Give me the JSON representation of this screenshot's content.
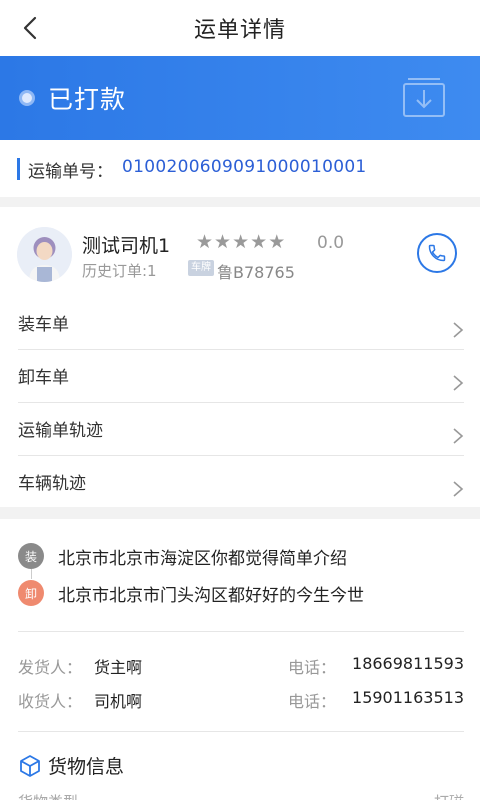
{
  "nav": {
    "title": "运单详情",
    "back_icon": "chevron-left-icon"
  },
  "status": {
    "text": "已打款",
    "icon": "download-box-icon"
  },
  "order": {
    "label": "运输单号：",
    "number": "010020060909100001 0001"
  },
  "driver": {
    "name": "测试司机1",
    "stars": [
      "★",
      "★",
      "★",
      "★",
      "★"
    ],
    "rating": "0.0",
    "history": "历史订单:1",
    "plate_tag": "车牌",
    "plate": "鲁B78765",
    "phone_icon": "phone-icon"
  },
  "menu": [
    {
      "label": "装车单"
    },
    {
      "label": "卸车单"
    },
    {
      "label": "运输单轨迹"
    },
    {
      "label": "车辆轨迹"
    }
  ],
  "addresses": {
    "load_badge": "装",
    "load_address": "北京市北京市海淀区你都觉得简单介绍",
    "unload_badge": "卸",
    "unload_address": "北京市北京市门头沟区都好好的今生今世"
  },
  "contacts": {
    "sender_label": "发货人：",
    "sender_name": "货主啊",
    "sender_tel_label": "电话：",
    "sender_tel": "18669811593",
    "receiver_label": "收货人：",
    "receiver_name": "司机啊",
    "receiver_tel_label": "电话：",
    "receiver_tel": "15901163513"
  },
  "goods": {
    "title": "货物信息",
    "icon": "cube-icon",
    "peek_left": "货物类型",
    "peek_right": "打磁"
  },
  "colors": {
    "primary": "#2c78e6",
    "unload_badge": "#ef8a6f",
    "load_badge": "#8a8a8a"
  }
}
